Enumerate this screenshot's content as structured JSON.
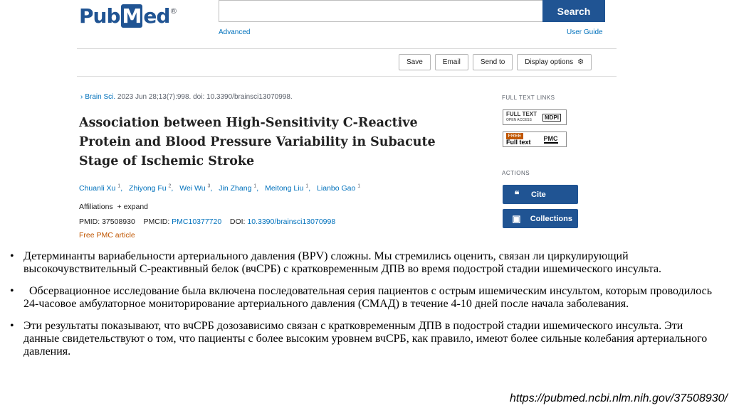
{
  "pubmed": {
    "logo": {
      "part1": "Pub",
      "part2": "M",
      "part3": "ed",
      "reg": "®"
    },
    "search": {
      "button": "Search",
      "value": "",
      "advanced": "Advanced",
      "user_guide": "User Guide"
    },
    "actions": {
      "save": "Save",
      "email": "Email",
      "send_to": "Send to",
      "display_options": "Display options"
    },
    "citation": {
      "chevron": "›",
      "journal": "Brain Sci.",
      "rest": " 2023 Jun 28;13(7):998. doi: 10.3390/brainsci13070998."
    },
    "title": "Association between High-Sensitivity C-Reactive Protein and Blood Pressure Variability in Subacute Stage of Ischemic Stroke",
    "authors": [
      {
        "name": "Chuanli Xu",
        "sup": "1"
      },
      {
        "name": "Zhiyong Fu",
        "sup": "2"
      },
      {
        "name": "Wei Wu",
        "sup": "3"
      },
      {
        "name": "Jin Zhang",
        "sup": "1"
      },
      {
        "name": "Meitong Liu",
        "sup": "1"
      },
      {
        "name": "Lianbo Gao",
        "sup": "1"
      }
    ],
    "affiliations": "Affiliations",
    "expand": "+ expand",
    "pmid_label": "PMID: ",
    "pmid": "37508930",
    "pmcid_label": "PMCID: ",
    "pmcid": "PMC10377720",
    "doi_label": "DOI: ",
    "doi": "10.3390/brainsci13070998",
    "free_pmc": "Free PMC article",
    "full_text_links_heading": "FULL TEXT LINKS",
    "mdpi_badge": {
      "line1": "FULL TEXT",
      "line2": "OPEN ACCESS",
      "brand": "MDPI"
    },
    "pmc_badge": {
      "free": "FREE",
      "text": "Full text",
      "brand": "PMC"
    },
    "actions_heading": "ACTIONS",
    "cite": "Cite",
    "collections": "Collections"
  },
  "bullets": [
    "Детерминанты вариабельности артериального давления (BPV) сложны. Мы стремились оценить, связан ли циркулирующий высокочувствительный С-реактивный белок (вчСРБ) с кратковременным ДПВ во время подострой стадии ишемического инсульта.",
    "  Обсервационное исследование была включена последовательная серия пациентов с острым ишемическим инсультом, которым проводилось 24-часовое амбулаторное мониторирование артериального давления (СМАД) в течение 4-10 дней после начала заболевания.",
    "Эти результаты показывают, что вчСРБ дозозависимо связан с кратковременным ДПВ в подострой стадии ишемического инсульта. Эти данные свидетельствуют о том, что пациенты с более высоким уровнем вчСРБ, как правило, имеют более сильные колебания артериального давления."
  ],
  "source_url": "https://pubmed.ncbi.nlm.nih.gov/37508930/",
  "colors": {
    "brand": "#205493",
    "link": "#0071bc",
    "free": "#c05600"
  }
}
